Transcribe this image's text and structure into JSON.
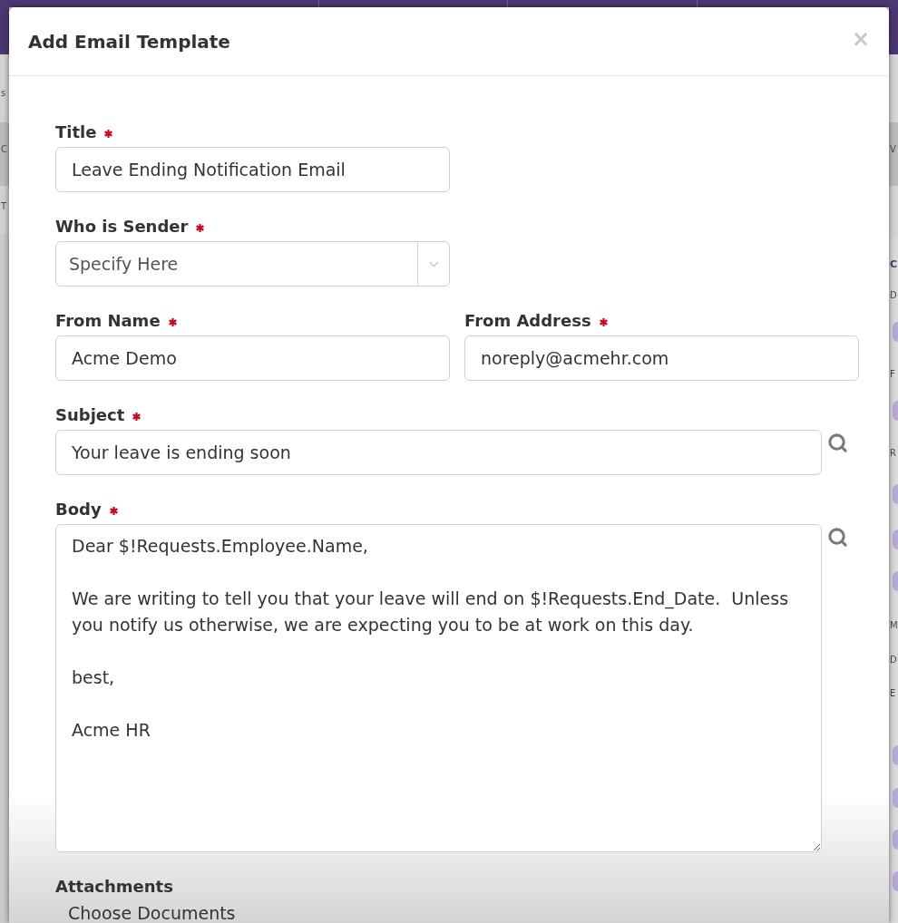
{
  "background_page": {
    "left_edge": [
      {
        "kind": "text",
        "text": "s"
      },
      {
        "kind": "text",
        "text": "C"
      },
      {
        "kind": "text",
        "text": "T"
      }
    ],
    "right_edge": [
      {
        "kind": "text",
        "text": "V"
      },
      {
        "kind": "heading",
        "text": "C"
      },
      {
        "kind": "text",
        "text": "D"
      },
      {
        "kind": "avatar"
      },
      {
        "kind": "text",
        "text": "F"
      },
      {
        "kind": "avatar"
      },
      {
        "kind": "text",
        "text": "R"
      },
      {
        "kind": "avatar"
      },
      {
        "kind": "avatar"
      },
      {
        "kind": "avatar"
      },
      {
        "kind": "text",
        "text": "M"
      },
      {
        "kind": "text",
        "text": "D"
      },
      {
        "kind": "text",
        "text": "E"
      },
      {
        "kind": "avatar"
      },
      {
        "kind": "avatar"
      },
      {
        "kind": "avatar"
      },
      {
        "kind": "avatar"
      }
    ]
  },
  "dialog": {
    "title": "Add Email Template",
    "close": "×",
    "rows": [
      {
        "fields": [
          {
            "kind": "input",
            "label": "Title",
            "required": true,
            "value": "Leave Ending Notification Email"
          }
        ]
      },
      {
        "fields": [
          {
            "kind": "select",
            "label": "Who is Sender",
            "required": true,
            "placeholder": "Specify Here"
          }
        ]
      },
      {
        "fields": [
          {
            "kind": "input",
            "label": "From Name",
            "required": true,
            "value": "Acme Demo"
          },
          {
            "kind": "input",
            "label": "From Address",
            "required": true,
            "value": "noreply@acmehr.com"
          }
        ]
      },
      {
        "fields": [
          {
            "kind": "input",
            "label": "Subject",
            "required": true,
            "value": "Your leave is ending soon",
            "lookup": true
          }
        ]
      },
      {
        "fields": [
          {
            "kind": "textarea",
            "label": "Body",
            "required": true,
            "value": "Dear $!Requests.Employee.Name,\n\nWe are writing to tell you that your leave will end on $!Requests.End_Date.  Unless you notify us otherwise, we are expecting you to be at work on this day.\n\nbest,\n\nAcme HR",
            "lookup": true
          }
        ]
      },
      {
        "fields": [
          {
            "kind": "documents",
            "label": "Attachments",
            "placeholder": "Choose Documents"
          }
        ]
      }
    ]
  }
}
